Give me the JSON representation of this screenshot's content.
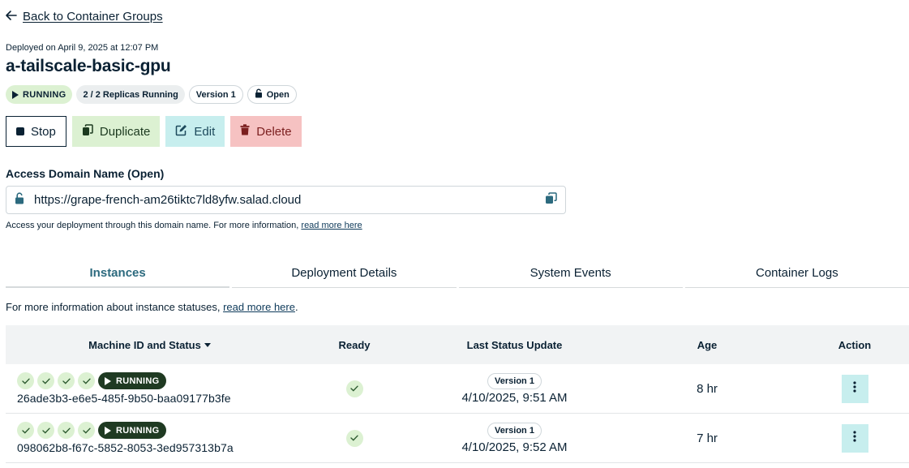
{
  "nav": {
    "back_label": "Back to Container Groups"
  },
  "header": {
    "deployed": "Deployed on April 9, 2025 at 12:07 PM",
    "title": "a-tailscale-basic-gpu",
    "badges": {
      "status": "RUNNING",
      "replicas": "2 / 2 Replicas Running",
      "version": "Version 1",
      "access": "Open"
    }
  },
  "actions": {
    "stop": "Stop",
    "duplicate": "Duplicate",
    "edit": "Edit",
    "delete": "Delete"
  },
  "access_domain": {
    "label": "Access Domain Name (Open)",
    "url": "https://grape-french-am26tiktc7ld8yfw.salad.cloud",
    "help_text": "Access your deployment through this domain name. For more information, ",
    "help_link": "read more here"
  },
  "tabs": [
    {
      "label": "Instances"
    },
    {
      "label": "Deployment Details"
    },
    {
      "label": "System Events"
    },
    {
      "label": "Container Logs"
    }
  ],
  "instances": {
    "help_text": "For more information about instance statuses, ",
    "help_link": "read more here",
    "help_end": ".",
    "columns": {
      "machine": "Machine ID and Status",
      "ready": "Ready",
      "last_update": "Last Status Update",
      "age": "Age",
      "action": "Action"
    },
    "rows": [
      {
        "status": "RUNNING",
        "machine_id": "26ade3b3-e6e5-485f-9b50-baa09177b3fe",
        "version": "Version 1",
        "last_update": "4/10/2025, 9:51 AM",
        "age": "8 hr"
      },
      {
        "status": "RUNNING",
        "machine_id": "098062b8-f67c-5852-8053-3ed957313b7a",
        "version": "Version 1",
        "last_update": "4/10/2025, 9:52 AM",
        "age": "7 hr"
      }
    ]
  },
  "colors": {
    "primary_text": "#0a2133",
    "running_light": "#dcf1d2",
    "running_dark": "#1f3a22",
    "edit_bg": "#c7eeee",
    "delete_bg": "#f6c2c2",
    "active_tab": "#2c6a7e"
  }
}
